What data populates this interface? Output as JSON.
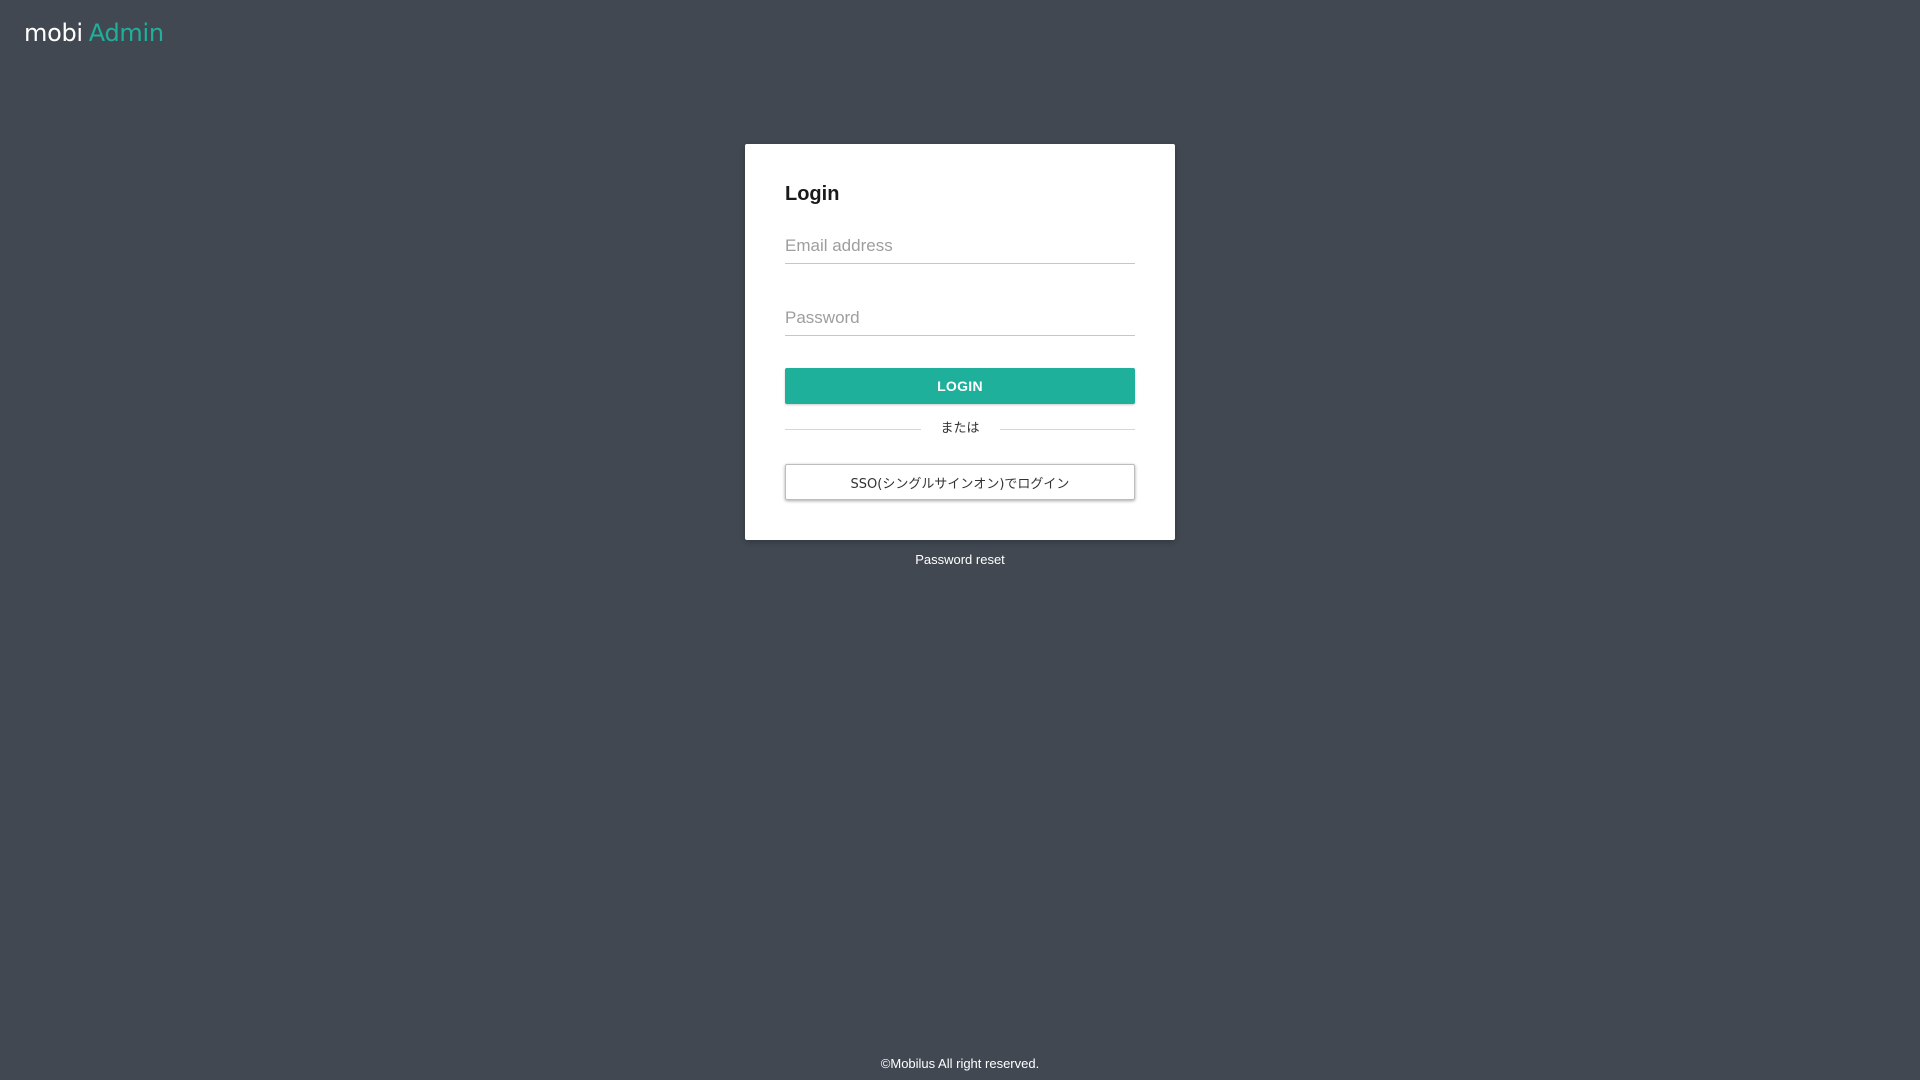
{
  "header": {
    "logo_part1": "mobi",
    "logo_part2": "Admin"
  },
  "login_card": {
    "title": "Login",
    "email_placeholder": "Email address",
    "password_placeholder": "Password",
    "login_button": "LOGIN",
    "divider_text": "または",
    "sso_button": "SSO(シングルサインオン)でログイン"
  },
  "links": {
    "password_reset": "Password reset"
  },
  "footer": {
    "copyright": "©Mobilus All right reserved."
  },
  "colors": {
    "background": "#424852",
    "accent": "#1eb09b",
    "card": "#ffffff"
  }
}
